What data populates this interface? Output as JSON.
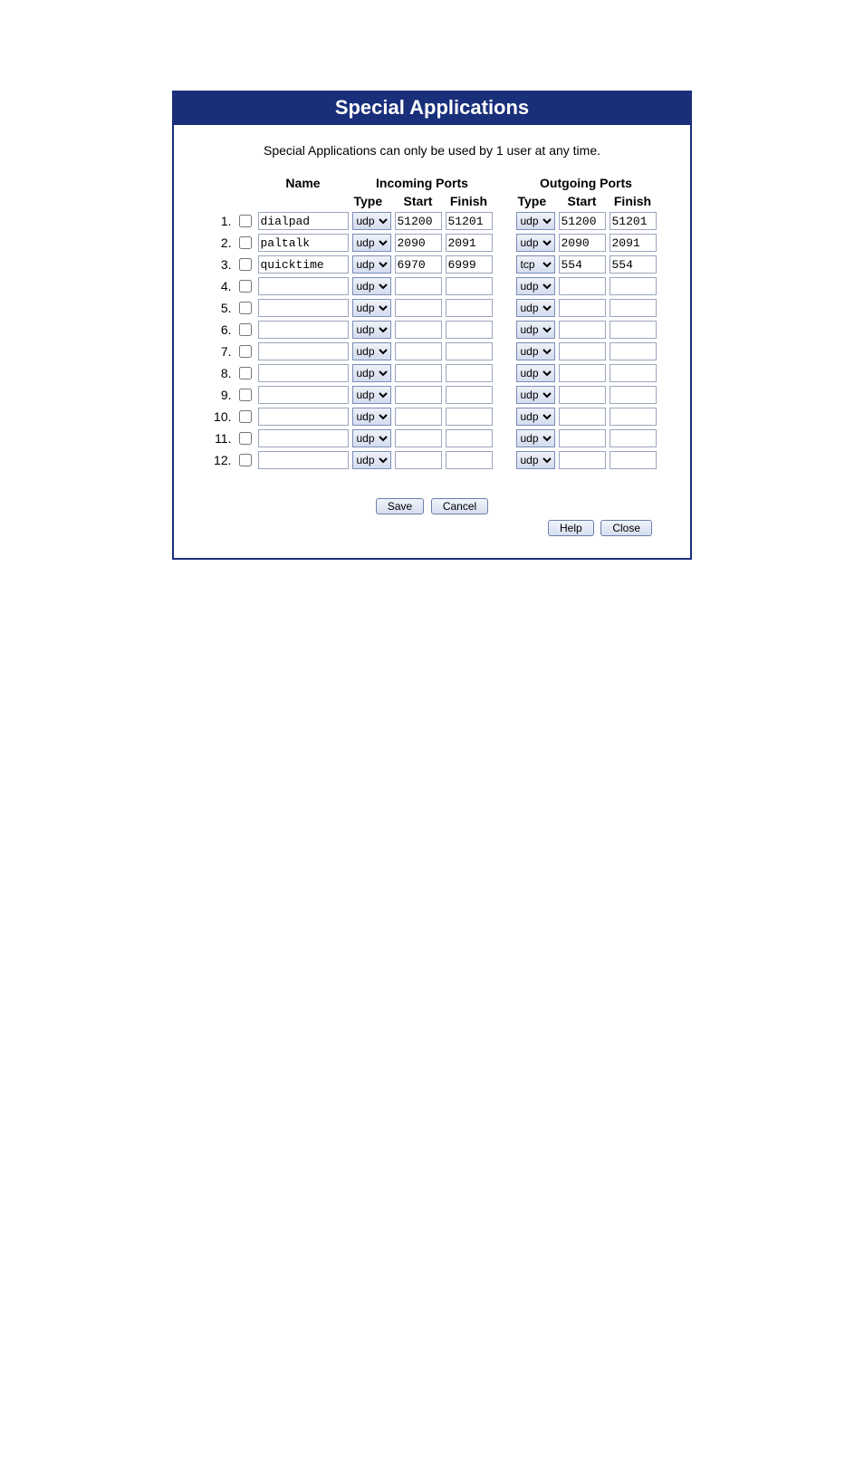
{
  "header": {
    "title": "Special Applications"
  },
  "subtitle": "Special Applications can only be used by 1 user at any time.",
  "columns": {
    "name": "Name",
    "incoming": "Incoming Ports",
    "outgoing": "Outgoing Ports",
    "type": "Type",
    "start": "Start",
    "finish": "Finish"
  },
  "select_options": [
    "udp",
    "tcp"
  ],
  "rows": [
    {
      "num": "1.",
      "checked": false,
      "name": "dialpad",
      "in_type": "udp",
      "in_start": "51200",
      "in_finish": "51201",
      "out_type": "udp",
      "out_start": "51200",
      "out_finish": "51201"
    },
    {
      "num": "2.",
      "checked": false,
      "name": "paltalk",
      "in_type": "udp",
      "in_start": "2090",
      "in_finish": "2091",
      "out_type": "udp",
      "out_start": "2090",
      "out_finish": "2091"
    },
    {
      "num": "3.",
      "checked": false,
      "name": "quicktime",
      "in_type": "udp",
      "in_start": "6970",
      "in_finish": "6999",
      "out_type": "tcp",
      "out_start": "554",
      "out_finish": "554"
    },
    {
      "num": "4.",
      "checked": false,
      "name": "",
      "in_type": "udp",
      "in_start": "",
      "in_finish": "",
      "out_type": "udp",
      "out_start": "",
      "out_finish": ""
    },
    {
      "num": "5.",
      "checked": false,
      "name": "",
      "in_type": "udp",
      "in_start": "",
      "in_finish": "",
      "out_type": "udp",
      "out_start": "",
      "out_finish": ""
    },
    {
      "num": "6.",
      "checked": false,
      "name": "",
      "in_type": "udp",
      "in_start": "",
      "in_finish": "",
      "out_type": "udp",
      "out_start": "",
      "out_finish": ""
    },
    {
      "num": "7.",
      "checked": false,
      "name": "",
      "in_type": "udp",
      "in_start": "",
      "in_finish": "",
      "out_type": "udp",
      "out_start": "",
      "out_finish": ""
    },
    {
      "num": "8.",
      "checked": false,
      "name": "",
      "in_type": "udp",
      "in_start": "",
      "in_finish": "",
      "out_type": "udp",
      "out_start": "",
      "out_finish": ""
    },
    {
      "num": "9.",
      "checked": false,
      "name": "",
      "in_type": "udp",
      "in_start": "",
      "in_finish": "",
      "out_type": "udp",
      "out_start": "",
      "out_finish": ""
    },
    {
      "num": "10.",
      "checked": false,
      "name": "",
      "in_type": "udp",
      "in_start": "",
      "in_finish": "",
      "out_type": "udp",
      "out_start": "",
      "out_finish": ""
    },
    {
      "num": "11.",
      "checked": false,
      "name": "",
      "in_type": "udp",
      "in_start": "",
      "in_finish": "",
      "out_type": "udp",
      "out_start": "",
      "out_finish": ""
    },
    {
      "num": "12.",
      "checked": false,
      "name": "",
      "in_type": "udp",
      "in_start": "",
      "in_finish": "",
      "out_type": "udp",
      "out_start": "",
      "out_finish": ""
    }
  ],
  "buttons": {
    "save": "Save",
    "cancel": "Cancel",
    "help": "Help",
    "close": "Close"
  }
}
